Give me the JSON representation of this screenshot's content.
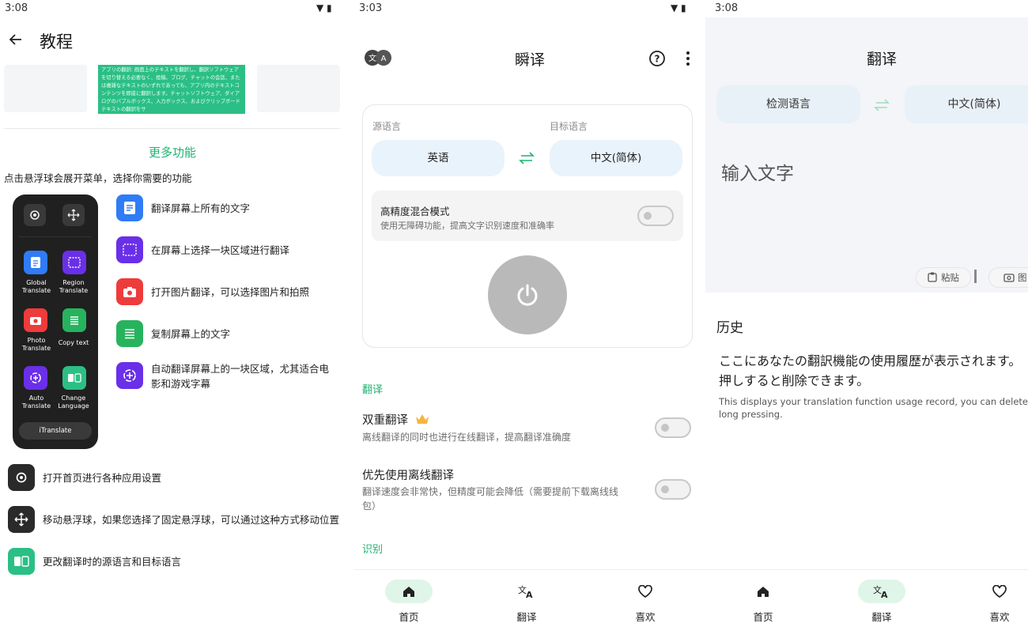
{
  "panel1": {
    "time": "3:08",
    "header_title": "教程",
    "preview_text": "アプリの翻訳: 画面上のテキストを翻訳し、翻訳ソフトウェアを切り替える必要なく、投稿、ブログ、チャットの会話、または複雑なテキストのいずれであっても、アプリ内のテキストコンテンツを即座に翻訳します。チャットソフトウェア、ダイアログのバブルボックス、入力ボックス、およびクリップボードテキストの翻訳をサ",
    "more_features": "更多功能",
    "menu_hint": "点击悬浮球会展开菜单，选择你需要的功能",
    "phone_tiles": [
      {
        "label_line1": "Global",
        "label_line2": "Translate",
        "icon": "document-icon",
        "color": "#2f7cf6"
      },
      {
        "label_line1": "Region",
        "label_line2": "Translate",
        "icon": "region-select-icon",
        "color": "#6a2fe8"
      },
      {
        "label_line1": "Photo",
        "label_line2": "Translate",
        "icon": "camera-icon",
        "color": "#ee3b3b"
      },
      {
        "label_line1": "Copy text",
        "label_line2": "",
        "icon": "copy-text-icon",
        "color": "#27b35e"
      },
      {
        "label_line1": "Auto",
        "label_line2": "Translate",
        "icon": "auto-translate-icon",
        "color": "#6a2fe8"
      },
      {
        "label_line1": "Change",
        "label_line2": "Language",
        "icon": "swap-language-icon",
        "color": "#2bbf85"
      }
    ],
    "phone_button": "iTranslate",
    "features": [
      {
        "text": "翻译屏幕上所有的文字",
        "icon": "document-icon"
      },
      {
        "text": "在屏幕上选择一块区域进行翻译",
        "icon": "region-select-icon"
      },
      {
        "text": "打开图片翻译，可以选择图片和拍照",
        "icon": "camera-icon"
      },
      {
        "text": "复制屏幕上的文字",
        "icon": "copy-text-icon"
      },
      {
        "text_line1": "自动翻译屏幕上的一块区域，尤其适合电",
        "text_line2": "影和游戏字幕",
        "icon": "auto-translate-icon"
      }
    ],
    "bottom_features": [
      {
        "text": "打开首页进行各种应用设置",
        "icon": "gear-icon"
      },
      {
        "text": "移动悬浮球，如果您选择了固定悬浮球，可以通过这种方式移动位置",
        "icon": "move-icon"
      },
      {
        "text": "更改翻译时的源语言和目标语言",
        "icon": "swap-language-icon"
      }
    ]
  },
  "panel2": {
    "time": "3:03",
    "app_title": "瞬译",
    "source_label": "源语言",
    "target_label": "目标语言",
    "source_lang": "英语",
    "target_lang": "中文(简体)",
    "hp_mode_title": "高精度混合模式",
    "hp_mode_sub": "使用无障碍功能，提高文字识别速度和准确率",
    "section_translate": "翻译",
    "dual_title": "双重翻译",
    "dual_sub": "离线翻译的同时也进行在线翻译，提高翻译准确度",
    "offline_title": "优先使用离线翻译",
    "offline_sub_line1": "翻译速度会非常快，但精度可能会降低（需要提前下载离线线",
    "offline_sub_line2": "包）",
    "section_recognize": "识别",
    "nav": [
      "首页",
      "翻译",
      "喜欢"
    ]
  },
  "panel3": {
    "time": "3:08",
    "title": "翻译",
    "detect_lang": "检测语言",
    "target_lang": "中文(简体)",
    "input_placeholder": "输入文字",
    "paste_label": "粘贴",
    "image_label": "图",
    "history_title": "历史",
    "history_jp_line1": "ここにあなたの翻訳機能の使用履歴が表示されます。",
    "history_jp_line2": "押しすると削除できます。",
    "history_en_line1": "This displays your translation function usage record, you can delete it",
    "history_en_line2": "long pressing.",
    "nav": [
      "首页",
      "翻译",
      "喜欢"
    ]
  },
  "colors": {
    "accent_green": "#1db370",
    "nav_pill": "#dff5e8",
    "power_grey": "#b9b9b9"
  }
}
